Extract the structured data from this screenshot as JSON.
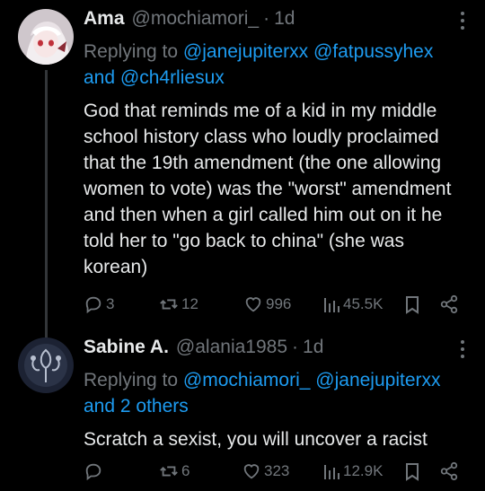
{
  "tweets": [
    {
      "name": "Ama",
      "handle": "@mochiamori_",
      "time": "1d",
      "replying_prefix": "Replying to",
      "mentions": [
        "@janejupiterxx",
        "@fatpussyhex"
      ],
      "replying_and": "and",
      "mention_last": "@ch4rliesux",
      "text": "God that reminds me of a kid in my middle school history class who loudly proclaimed that the 19th amendment (the one allowing women to vote) was the \"worst\" amendment and then when a girl called him out on it he told her to \"go back to china\" (she was korean)",
      "replies": "3",
      "retweets": "12",
      "likes": "996",
      "views": "45.5K"
    },
    {
      "name": "Sabine A.",
      "handle": "@alania1985",
      "time": "1d",
      "replying_prefix": "Replying to",
      "mentions": [
        "@mochiamori_",
        "@janejupiterxx"
      ],
      "replying_and": "and 2 others",
      "text": "Scratch a sexist, you will uncover a racist",
      "replies": "",
      "retweets": "6",
      "likes": "323",
      "views": "12.9K"
    }
  ],
  "colors": {
    "background": "#000000",
    "text": "#e7e9ea",
    "muted": "#71767b",
    "link": "#1d9bf0"
  },
  "icons": [
    "reply-icon",
    "retweet-icon",
    "like-icon",
    "views-icon",
    "bookmark-icon",
    "share-icon",
    "more-icon"
  ]
}
